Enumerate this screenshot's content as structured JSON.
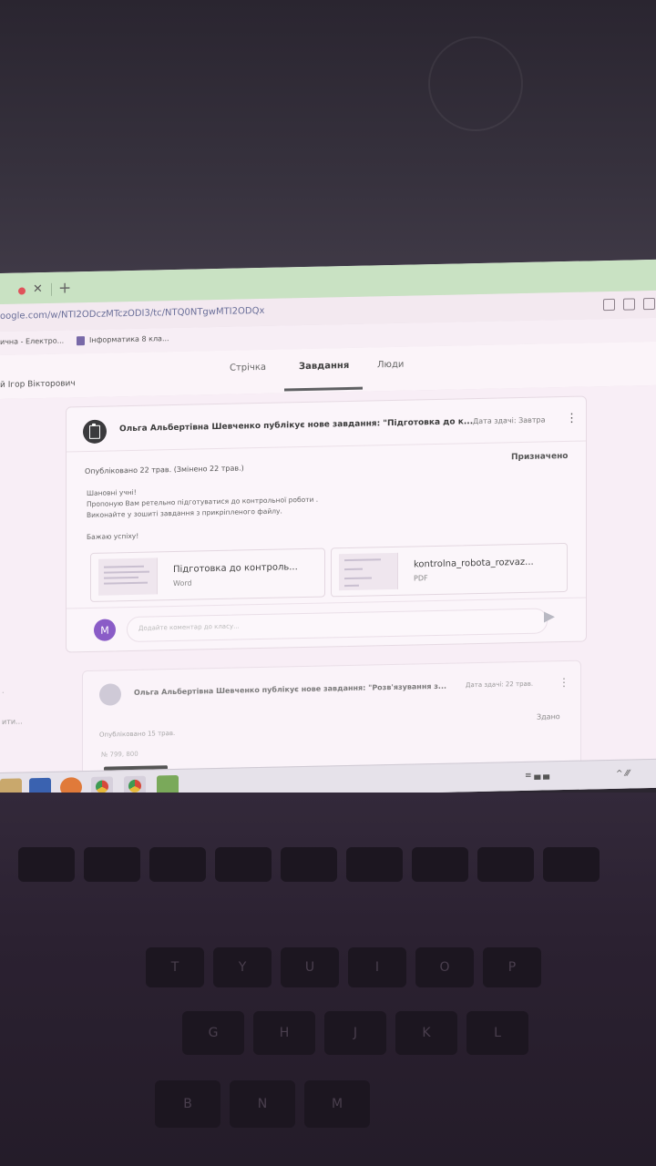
{
  "browser": {
    "url": "oogle.com/w/NTI2ODczMTczODI3/tc/NTQ0NTgwMTI2ODQx",
    "bookmarks": [
      "ична - Електро...",
      "Інформатика 8 кла..."
    ]
  },
  "classroom": {
    "teacher": "й Ігор Вікторович",
    "tabs": [
      "Стрічка",
      "Завдання",
      "Люди"
    ],
    "active_tab": "Завдання"
  },
  "assignment": {
    "title": "Ольга Альбертівна Шевченко публікує нове завдання: \"Підготовка до к...",
    "due": "Дата здачі: Завтра",
    "published": "Опубліковано 22 трав. (Змінено 22 трав.)",
    "status": "Призначено",
    "body": [
      "Шановні учні!",
      "Пропоную Вам ретельно підготуватися до контрольної роботи .",
      "Виконайте у зошиті завдання з прикріпленого файлу.",
      "",
      "Бажаю успіху!"
    ],
    "attachments": [
      {
        "name": "Підготовка до контроль...",
        "type": "Word"
      },
      {
        "name": "kontrolna_robota_rozvaz...",
        "type": "PDF"
      }
    ],
    "comment": {
      "avatar": "M",
      "placeholder": "Додайте коментар до класу..."
    }
  },
  "assignment2": {
    "title": "Ольга Альбертівна Шевченко публікує нове завдання: \"Розв'язування з...",
    "due": "Дата здачі: 22 трав.",
    "published": "Опубліковано 15 трав.",
    "status": "Здано",
    "extra": "№ 799, 800"
  },
  "left_marks": [
    "·",
    "ити..."
  ],
  "tray": {
    "left": "≡ ▄ ▄",
    "right": "^ ⁄⁄⁄"
  },
  "keyboard_letters": [
    "T",
    "Y",
    "U",
    "I",
    "O",
    "P",
    "G",
    "H",
    "J",
    "K",
    "L",
    "B",
    "N",
    "M"
  ]
}
